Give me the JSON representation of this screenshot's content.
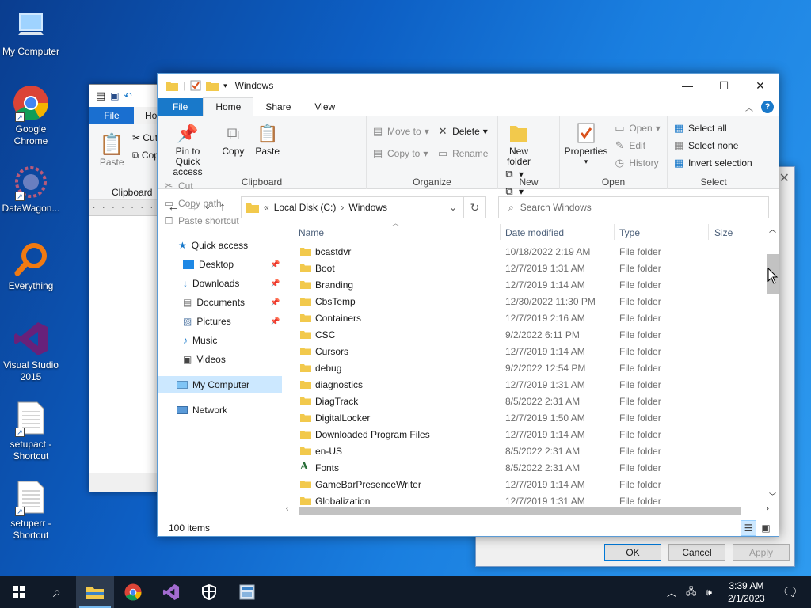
{
  "desktop": {
    "icons": [
      {
        "label": "My Computer",
        "icon": "monitor-icon"
      },
      {
        "label": "Google Chrome",
        "icon": "chrome-icon"
      },
      {
        "label": "DataWagon...",
        "icon": "datawagon-icon"
      },
      {
        "label": "Everything",
        "icon": "everything-search-icon"
      },
      {
        "label": "Visual Studio 2015",
        "icon": "visual-studio-icon"
      },
      {
        "label": "setupact - Shortcut",
        "icon": "text-file-icon"
      },
      {
        "label": "setuperr - Shortcut",
        "icon": "text-file-icon"
      }
    ]
  },
  "back_window": {
    "file_tab": "File",
    "home_tab": "Ho",
    "cut": "Cut",
    "copy": "Cop",
    "paste": "Paste",
    "clipboard": "Clipboard"
  },
  "dialog": {
    "ok": "OK",
    "cancel": "Cancel",
    "apply": "Apply"
  },
  "explorer": {
    "title": "Windows",
    "tabs": {
      "file": "File",
      "home": "Home",
      "share": "Share",
      "view": "View"
    },
    "ribbon": {
      "pin": "Pin to Quick access",
      "copy": "Copy",
      "paste": "Paste",
      "cut": "Cut",
      "copy_path": "Copy path",
      "paste_shortcut": "Paste shortcut",
      "clipboard": "Clipboard",
      "move_to": "Move to",
      "copy_to": "Copy to",
      "delete": "Delete",
      "rename": "Rename",
      "organize": "Organize",
      "new_folder": "New folder",
      "new": "New",
      "properties": "Properties",
      "open": "Open",
      "edit": "Edit",
      "history": "History",
      "open_group": "Open",
      "select_all": "Select all",
      "select_none": "Select none",
      "invert_selection": "Invert selection",
      "select_group": "Select"
    },
    "address": {
      "prefix": "«",
      "drive": "Local Disk (C:)",
      "sep": "›",
      "folder": "Windows"
    },
    "search": {
      "placeholder": "Search Windows"
    },
    "nav": {
      "quick_access": "Quick access",
      "desktop": "Desktop",
      "downloads": "Downloads",
      "documents": "Documents",
      "pictures": "Pictures",
      "music": "Music",
      "videos": "Videos",
      "my_computer": "My Computer",
      "network": "Network"
    },
    "columns": {
      "name": "Name",
      "date": "Date modified",
      "type": "Type",
      "size": "Size"
    },
    "files": [
      {
        "name": "bcastdvr",
        "date": "10/18/2022 2:19 AM",
        "type": "File folder"
      },
      {
        "name": "Boot",
        "date": "12/7/2019 1:31 AM",
        "type": "File folder"
      },
      {
        "name": "Branding",
        "date": "12/7/2019 1:14 AM",
        "type": "File folder"
      },
      {
        "name": "CbsTemp",
        "date": "12/30/2022 11:30 PM",
        "type": "File folder"
      },
      {
        "name": "Containers",
        "date": "12/7/2019 2:16 AM",
        "type": "File folder"
      },
      {
        "name": "CSC",
        "date": "9/2/2022 6:11 PM",
        "type": "File folder"
      },
      {
        "name": "Cursors",
        "date": "12/7/2019 1:14 AM",
        "type": "File folder"
      },
      {
        "name": "debug",
        "date": "9/2/2022 12:54 PM",
        "type": "File folder"
      },
      {
        "name": "diagnostics",
        "date": "12/7/2019 1:31 AM",
        "type": "File folder"
      },
      {
        "name": "DiagTrack",
        "date": "8/5/2022 2:31 AM",
        "type": "File folder"
      },
      {
        "name": "DigitalLocker",
        "date": "12/7/2019 1:50 AM",
        "type": "File folder"
      },
      {
        "name": "Downloaded Program Files",
        "date": "12/7/2019 1:14 AM",
        "type": "File folder"
      },
      {
        "name": "en-US",
        "date": "8/5/2022 2:31 AM",
        "type": "File folder"
      },
      {
        "name": "Fonts",
        "date": "8/5/2022 2:31 AM",
        "type": "File folder",
        "special": "fonts"
      },
      {
        "name": "GameBarPresenceWriter",
        "date": "12/7/2019 1:14 AM",
        "type": "File folder"
      },
      {
        "name": "Globalization",
        "date": "12/7/2019 1:31 AM",
        "type": "File folder"
      }
    ],
    "status": "100 items"
  },
  "taskbar": {
    "time": "3:39 AM",
    "date": "2/1/2023"
  },
  "colors": {
    "accent": "#1979ca",
    "folder": "#f2c94c",
    "taskbar": "#101a28"
  }
}
